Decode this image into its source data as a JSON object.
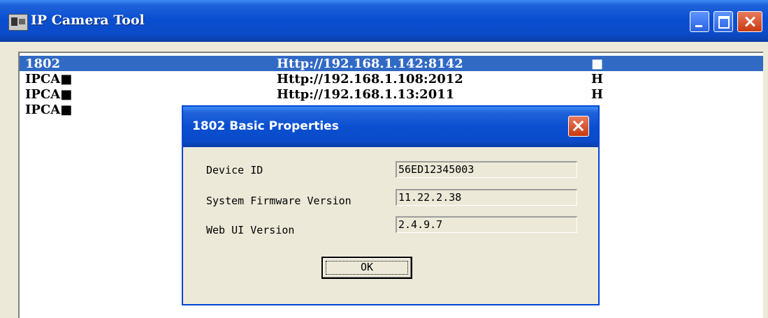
{
  "window": {
    "title": "IP Camera Tool",
    "icon": "camera-app-icon"
  },
  "devices": [
    {
      "name": "1802",
      "url": "Http://192.168.1.142:8142",
      "flag": "■",
      "selected": true
    },
    {
      "name": "IPCA■",
      "url": "Http://192.168.1.108:2012",
      "flag": "H",
      "selected": false
    },
    {
      "name": "IPCA■",
      "url": "Http://192.168.1.13:2011",
      "flag": "H",
      "selected": false
    },
    {
      "name": "IPCA■",
      "url": "",
      "flag": "",
      "selected": false
    }
  ],
  "dialog": {
    "title": "1802 Basic Properties",
    "fields": [
      {
        "label": "Device ID",
        "value": "56ED12345003"
      },
      {
        "label": "System Firmware Version",
        "value": "11.22.2.38"
      },
      {
        "label": "Web UI Version",
        "value": "2.4.9.7"
      }
    ],
    "ok_label": "OK"
  },
  "colors": {
    "title_blue": "#0a4fd1",
    "selection": "#316ac5",
    "close_red": "#c83a10",
    "dialog_bg": "#ece9d8"
  }
}
